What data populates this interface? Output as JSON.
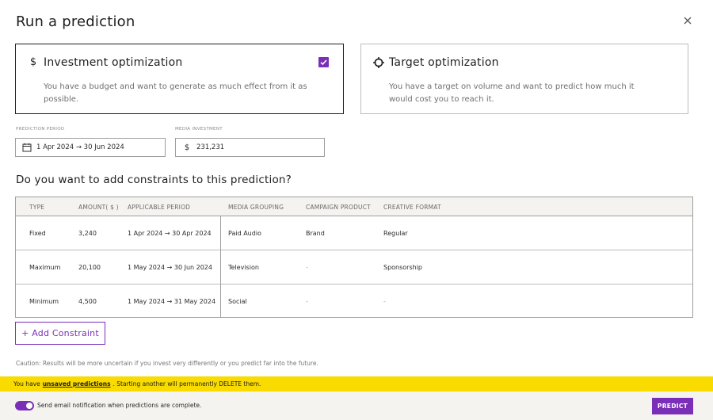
{
  "title": "Run a prediction",
  "cards": [
    {
      "icon": "$",
      "title": "Investment optimization",
      "description": "You have a budget and want to generate as much effect from it as possible.",
      "selected": true
    },
    {
      "icon": "crosshair",
      "title": "Target optimization",
      "description": "You have a target on volume and want to predict how much it would cost you to reach it.",
      "selected": false
    }
  ],
  "fields": {
    "period": {
      "label": "PREDICTION PERIOD",
      "value": "1 Apr 2024 → 30 Jun 2024"
    },
    "investment": {
      "label": "MEDIA INVESTMENT",
      "currency": "$",
      "value": "231,231"
    }
  },
  "constraints": {
    "heading": "Do you want to add constraints to this prediction?",
    "columns": [
      "TYPE",
      "AMOUNT( $ )",
      "APPLICABLE PERIOD",
      "MEDIA GROUPING",
      "CAMPAIGN PRODUCT",
      "CREATIVE FORMAT"
    ],
    "rows": [
      {
        "type": "Fixed",
        "amount": "3,240",
        "period": "1 Apr 2024 → 30 Apr 2024",
        "grouping": "Paid Audio",
        "product": "Brand",
        "format": "Regular"
      },
      {
        "type": "Maximum",
        "amount": "20,100",
        "period": "1 May 2024 → 30 Jun 2024",
        "grouping": "Television",
        "product": "-",
        "format": "Sponsorship"
      },
      {
        "type": "Minimum",
        "amount": "4,500",
        "period": "1 May 2024 → 31 May 2024",
        "grouping": "Social",
        "product": "-",
        "format": "-"
      }
    ],
    "add_label": "+ Add Constraint"
  },
  "caution": "Caution: Results will be more uncertain if you invest very differently or you predict far into the future.",
  "banner": {
    "prefix": "You have",
    "bold": "unsaved predictions",
    "suffix": ". Starting another will permanently DELETE them."
  },
  "footer": {
    "toggle_label": "Send email notification when predictions are complete.",
    "toggle_on": true,
    "predict_label": "PREDICT"
  },
  "colors": {
    "accent": "#7b2fb8",
    "banner": "#f9db00",
    "footer_bg": "#f4f3ef"
  }
}
